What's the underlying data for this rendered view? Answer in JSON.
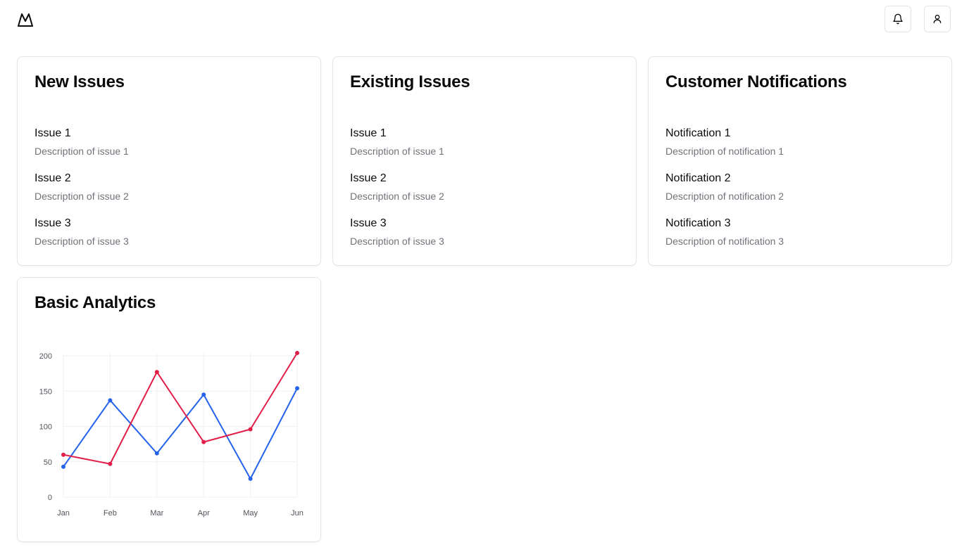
{
  "header": {
    "logo_icon": "mountain-logo-icon",
    "notifications_icon": "bell-icon",
    "profile_icon": "user-icon"
  },
  "cards": [
    {
      "title": "New Issues",
      "items": [
        {
          "title": "Issue 1",
          "description": "Description of issue 1"
        },
        {
          "title": "Issue 2",
          "description": "Description of issue 2"
        },
        {
          "title": "Issue 3",
          "description": "Description of issue 3"
        }
      ]
    },
    {
      "title": "Existing Issues",
      "items": [
        {
          "title": "Issue 1",
          "description": "Description of issue 1"
        },
        {
          "title": "Issue 2",
          "description": "Description of issue 2"
        },
        {
          "title": "Issue 3",
          "description": "Description of issue 3"
        }
      ]
    },
    {
      "title": "Customer Notifications",
      "items": [
        {
          "title": "Notification 1",
          "description": "Description of notification 1"
        },
        {
          "title": "Notification 2",
          "description": "Description of notification 2"
        },
        {
          "title": "Notification 3",
          "description": "Description of notification 3"
        }
      ]
    }
  ],
  "analytics": {
    "title": "Basic Analytics"
  },
  "chart_data": {
    "type": "line",
    "categories": [
      "Jan",
      "Feb",
      "Mar",
      "Apr",
      "May",
      "Jun"
    ],
    "series": [
      {
        "color": "#2563eb",
        "values": [
          43,
          137,
          62,
          145,
          26,
          154
        ]
      },
      {
        "color": "#e11d48",
        "values": [
          60,
          47,
          177,
          78,
          96,
          204
        ]
      }
    ],
    "ylim": [
      0,
      200
    ],
    "yticks": [
      "0",
      "50",
      "100",
      "150",
      "200"
    ],
    "grid": true,
    "legend": "none"
  }
}
